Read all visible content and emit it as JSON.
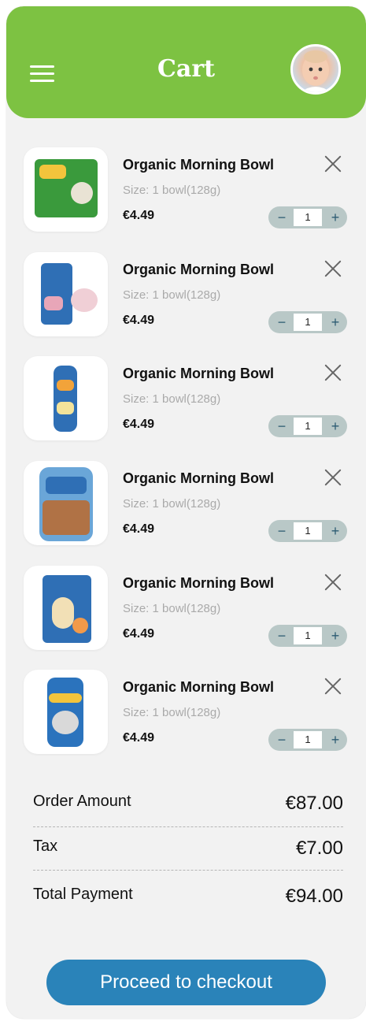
{
  "header": {
    "title": "Cart",
    "menu_icon": "hamburger-menu-icon",
    "avatar_icon": "baby-avatar"
  },
  "colors": {
    "header_bg": "#7dc242",
    "page_bg": "#f2f2f2",
    "checkout_bg": "#2a83b9",
    "stepper_bg": "#b9c8c7"
  },
  "cart": {
    "items": [
      {
        "name": "Organic Morning Bowl",
        "size": "Size: 1 bowl(128g)",
        "price": "€4.49",
        "qty": "1",
        "minus": "−",
        "plus": "+"
      },
      {
        "name": "Organic Morning Bowl",
        "size": "Size: 1 bowl(128g)",
        "price": "€4.49",
        "qty": "1",
        "minus": "−",
        "plus": "+"
      },
      {
        "name": "Organic Morning Bowl",
        "size": "Size: 1 bowl(128g)",
        "price": "€4.49",
        "qty": "1",
        "minus": "−",
        "plus": "+"
      },
      {
        "name": "Organic Morning Bowl",
        "size": "Size: 1 bowl(128g)",
        "price": "€4.49",
        "qty": "1",
        "minus": "−",
        "plus": "+"
      },
      {
        "name": "Organic Morning Bowl",
        "size": "Size: 1 bowl(128g)",
        "price": "€4.49",
        "qty": "1",
        "minus": "−",
        "plus": "+"
      },
      {
        "name": "Organic Morning Bowl",
        "size": "Size: 1 bowl(128g)",
        "price": "€4.49",
        "qty": "1",
        "minus": "−",
        "plus": "+"
      }
    ]
  },
  "summary": {
    "order_amount_label": "Order Amount",
    "order_amount_value": "€87.00",
    "tax_label": "Tax",
    "tax_value": "€7.00",
    "total_label": "Total Payment",
    "total_value": "€94.00"
  },
  "checkout": {
    "label": "Proceed to checkout"
  }
}
